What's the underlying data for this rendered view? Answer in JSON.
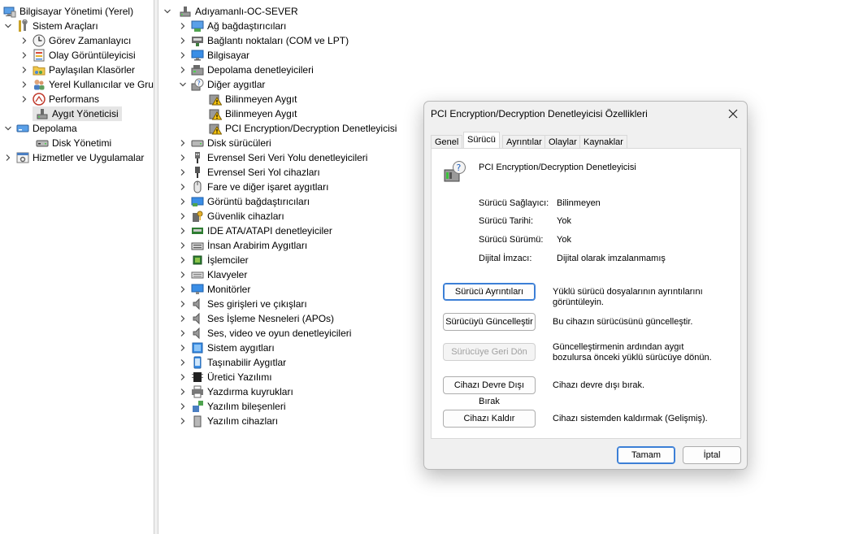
{
  "left_tree": {
    "items": [
      {
        "label": "Bilgisayar Yönetimi (Yerel)",
        "icon": "computer-management-icon"
      },
      {
        "label": "Sistem Araçları",
        "icon": "tools-icon"
      },
      {
        "label": "Görev Zamanlayıcı",
        "icon": "clock-icon"
      },
      {
        "label": "Olay Görüntüleyicisi",
        "icon": "event-viewer-icon"
      },
      {
        "label": "Paylaşılan Klasörler",
        "icon": "shared-folder-icon"
      },
      {
        "label": "Yerel Kullanıcılar ve Gru",
        "icon": "users-icon"
      },
      {
        "label": "Performans",
        "icon": "performance-icon"
      },
      {
        "label": "Aygıt Yöneticisi",
        "icon": "device-manager-icon"
      },
      {
        "label": "Depolama",
        "icon": "storage-icon"
      },
      {
        "label": "Disk Yönetimi",
        "icon": "disk-management-icon"
      },
      {
        "label": "Hizmetler ve Uygulamalar",
        "icon": "services-icon"
      }
    ]
  },
  "device_tree": {
    "root": "Adıyamanlı-OC-SEVER",
    "categories": [
      {
        "label": "Ağ bağdaştırıcıları",
        "icon": "network-adapter-icon"
      },
      {
        "label": "Bağlantı noktaları (COM ve LPT)",
        "icon": "port-icon"
      },
      {
        "label": "Bilgisayar",
        "icon": "computer-icon"
      },
      {
        "label": "Depolama denetleyicileri",
        "icon": "storage-controller-icon"
      },
      {
        "label": "Diğer aygıtlar",
        "icon": "unknown-device-icon"
      },
      {
        "label": "Disk sürücüleri",
        "icon": "disk-drive-icon"
      },
      {
        "label": "Evrensel Seri Veri Yolu denetleyicileri",
        "icon": "usb-icon"
      },
      {
        "label": "Evrensel Seri Yol cihazları",
        "icon": "usb-device-icon"
      },
      {
        "label": "Fare ve diğer işaret aygıtları",
        "icon": "mouse-icon"
      },
      {
        "label": "Görüntü bağdaştırıcıları",
        "icon": "display-adapter-icon"
      },
      {
        "label": "Güvenlik cihazları",
        "icon": "security-device-icon"
      },
      {
        "label": "IDE ATA/ATAPI denetleyiciler",
        "icon": "ide-icon"
      },
      {
        "label": "İnsan Arabirim Aygıtları",
        "icon": "hid-icon"
      },
      {
        "label": "İşlemciler",
        "icon": "processor-icon"
      },
      {
        "label": "Klavyeler",
        "icon": "keyboard-icon"
      },
      {
        "label": "Monitörler",
        "icon": "monitor-icon"
      },
      {
        "label": "Ses girişleri ve çıkışları",
        "icon": "audio-io-icon"
      },
      {
        "label": "Ses İşleme Nesneleri (APOs)",
        "icon": "audio-apo-icon"
      },
      {
        "label": "Ses, video ve oyun denetleyicileri",
        "icon": "sound-controller-icon"
      },
      {
        "label": "Sistem aygıtları",
        "icon": "system-device-icon"
      },
      {
        "label": "Taşınabilir Aygıtlar",
        "icon": "portable-device-icon"
      },
      {
        "label": "Üretici Yazılımı",
        "icon": "firmware-icon"
      },
      {
        "label": "Yazdırma kuyrukları",
        "icon": "printer-icon"
      },
      {
        "label": "Yazılım bileşenleri",
        "icon": "software-component-icon"
      },
      {
        "label": "Yazılım cihazları",
        "icon": "software-device-icon"
      }
    ],
    "other_devices": [
      {
        "label": "Bilinmeyen Aygıt",
        "icon": "warning-device-icon"
      },
      {
        "label": "Bilinmeyen Aygıt",
        "icon": "warning-device-icon"
      },
      {
        "label": "PCI Encryption/Decryption Denetleyicisi",
        "icon": "warning-device-icon"
      }
    ]
  },
  "dialog": {
    "title": "PCI Encryption/Decryption Denetleyicisi Özellikleri",
    "tabs": [
      "Genel",
      "Sürücü",
      "Ayrıntılar",
      "Olaylar",
      "Kaynaklar"
    ],
    "active_tab": "Sürücü",
    "device_name": "PCI Encryption/Decryption Denetleyicisi",
    "properties": [
      {
        "label": "Sürücü Sağlayıcı:",
        "value": "Bilinmeyen"
      },
      {
        "label": "Sürücü Tarihi:",
        "value": "Yok"
      },
      {
        "label": "Sürücü Sürümü:",
        "value": "Yok"
      },
      {
        "label": "Dijital İmzacı:",
        "value": "Dijital olarak imzalanmamış"
      }
    ],
    "actions": [
      {
        "label": "Sürücü Ayrıntıları",
        "desc": "Yüklü sürücü dosyalarının ayrıntılarını görüntüleyin.",
        "enabled": true
      },
      {
        "label": "Sürücüyü Güncelleştir",
        "desc": "Bu cihazın sürücüsünü güncelleştir.",
        "enabled": true
      },
      {
        "label": "Sürücüye Geri Dön",
        "desc": "Güncelleştirmenin ardından aygıt bozulursa önceki yüklü sürücüye dönün.",
        "enabled": false
      },
      {
        "label": "Cihazı Devre Dışı Bırak",
        "desc": "Cihazı devre dışı bırak.",
        "enabled": true
      },
      {
        "label": "Cihazı Kaldır",
        "desc": "Cihazı sistemden kaldırmak (Gelişmiş).",
        "enabled": true
      }
    ],
    "ok_label": "Tamam",
    "cancel_label": "İptal"
  }
}
